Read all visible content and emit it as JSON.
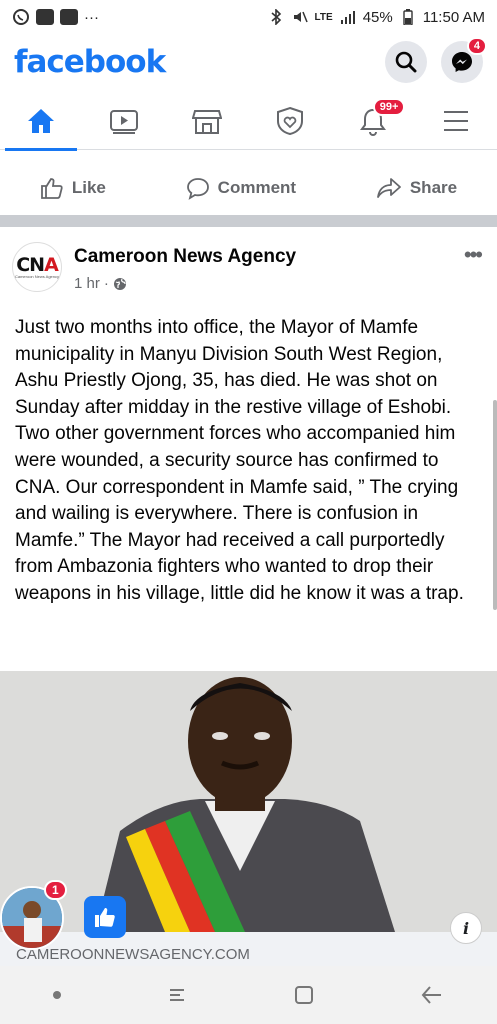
{
  "status_bar": {
    "time": "11:50 AM",
    "battery": "45%",
    "network": "LTE",
    "notif_more": "···"
  },
  "header": {
    "logo": "facebook",
    "messenger_badge": "4"
  },
  "nav": {
    "notifications_badge": "99+"
  },
  "actions": {
    "like": "Like",
    "comment": "Comment",
    "share": "Share"
  },
  "post": {
    "page_name": "Cameroon  News Agency",
    "time": "1 hr",
    "dot": "·",
    "avatar_text": "CNA",
    "avatar_sub": "Cameroon News Agency",
    "body": "Just two months into office, the Mayor of Mamfe municipality in Manyu Division South West Region, Ashu Priestly Ojong, 35, has died. He was shot on Sunday after midday in the restive village of Eshobi. Two other government forces who accompanied him were wounded, a security source has confirmed to CNA. Our correspondent in Mamfe said, ” The crying and wailing is everywhere. There is confusion in Mamfe.” The Mayor had received a call purportedly from Ambazonia fighters who wanted to drop their weapons in his village, little did he know it was a trap.",
    "link_domain": "CAMEROONNEWSAGENCY.COM",
    "more": "•••"
  },
  "chathead": {
    "badge": "1"
  },
  "colors": {
    "brand": "#1877f2",
    "badge": "#e41e3f",
    "sash_green": "#2e9e3a",
    "sash_red": "#e03323",
    "sash_yellow": "#f6d20e"
  }
}
